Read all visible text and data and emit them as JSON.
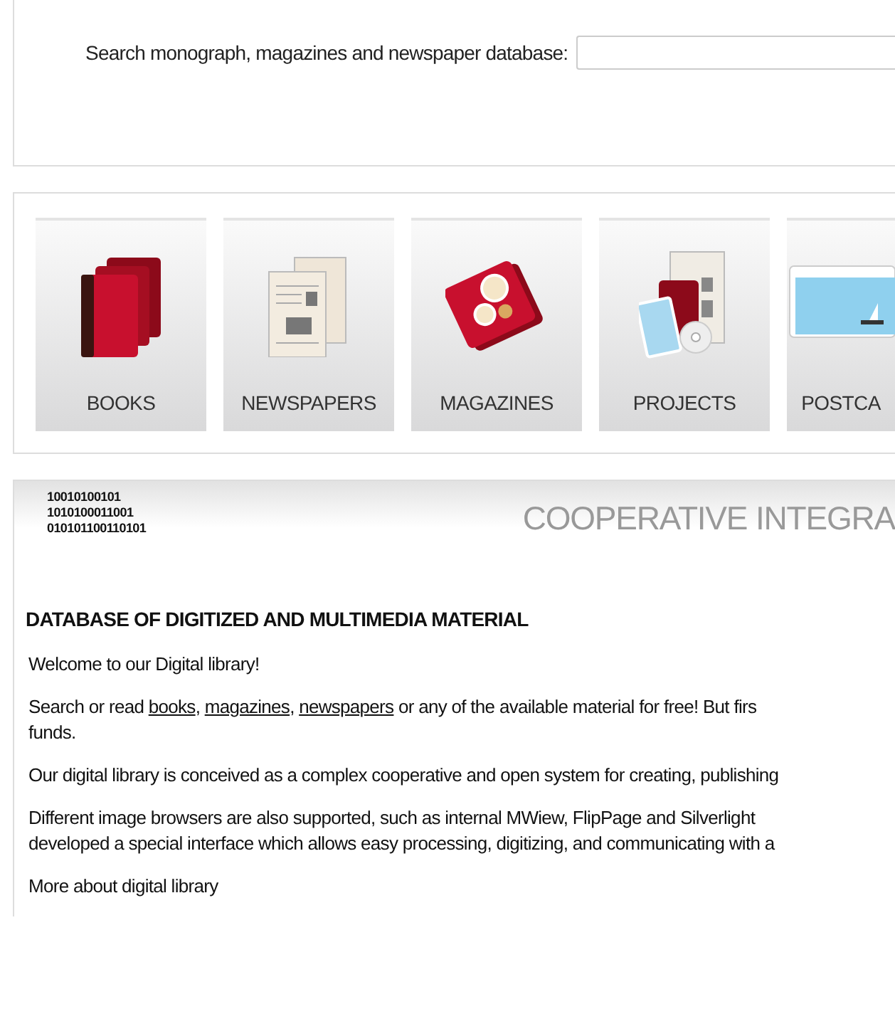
{
  "search": {
    "label": "Search monograph, magazines and newspaper database:"
  },
  "categories": [
    {
      "kind": "books",
      "label": "BOOKS"
    },
    {
      "kind": "newspapers",
      "label": "NEWSPAPERS"
    },
    {
      "kind": "magazines",
      "label": "MAGAZINES"
    },
    {
      "kind": "projects",
      "label": "PROJECTS"
    },
    {
      "kind": "postcards",
      "label": "POSTCA"
    }
  ],
  "banner": {
    "code_lines": [
      "10010100101",
      "1010100011001",
      "010101100110101"
    ],
    "title": "COOPERATIVE INTEGRA"
  },
  "article": {
    "heading": "DATABASE OF DIGITIZED AND MULTIMEDIA MATERIAL",
    "paragraphs": [
      {
        "parts": [
          {
            "kind": "text",
            "text": "Welcome to our Digital library!"
          }
        ]
      },
      {
        "parts": [
          {
            "kind": "text",
            "text": "Search or read "
          },
          {
            "kind": "link",
            "text": "books"
          },
          {
            "kind": "text",
            "text": ", "
          },
          {
            "kind": "link",
            "text": "magazines"
          },
          {
            "kind": "text",
            "text": ", "
          },
          {
            "kind": "link",
            "text": "newspapers"
          },
          {
            "kind": "text",
            "text": " or any of the available material for free! But firs"
          },
          {
            "kind": "break"
          },
          {
            "kind": "text",
            "text": "funds."
          }
        ]
      },
      {
        "parts": [
          {
            "kind": "text",
            "text": "Our digital library is conceived as a complex cooperative and open system for creating, publishing"
          }
        ]
      },
      {
        "parts": [
          {
            "kind": "text",
            "text": "Different image browsers are also supported, such as internal MWiew, FlipPage and Silverlight"
          },
          {
            "kind": "break"
          },
          {
            "kind": "text",
            "text": "developed a special interface which allows easy processing, digitizing, and communicating with a"
          }
        ]
      },
      {
        "parts": [
          {
            "kind": "text",
            "text": "More about digital library"
          }
        ]
      }
    ]
  }
}
